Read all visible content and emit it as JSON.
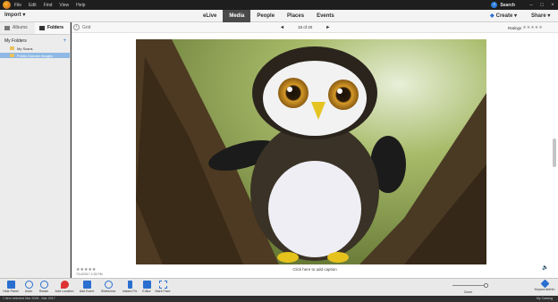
{
  "menubar": {
    "items": [
      "File",
      "Edit",
      "Find",
      "View",
      "Help"
    ],
    "search_label": "Search",
    "window_controls": [
      "–",
      "□",
      "×"
    ]
  },
  "topnav": {
    "import_label": "Import",
    "tabs": [
      "eLive",
      "Media",
      "People",
      "Places",
      "Events"
    ],
    "active_tab": "Media",
    "create_label": "Create",
    "share_label": "Share"
  },
  "left_panel": {
    "tabs": [
      "Albums",
      "Folders"
    ],
    "active_tab": "Folders",
    "section_title": "My Folders",
    "folders": [
      "My Scans",
      "Public Domain Images"
    ],
    "selected_folder": "Public Domain Images"
  },
  "main": {
    "view_label": "Grid",
    "pager_text": "18 of 20",
    "ratings_label": "Ratings",
    "rating_stars": "★★★★★",
    "photo_stars": "★★★★★",
    "photo_date": "7/14/2017 2:33 PM",
    "caption_hint": "Click here to add caption"
  },
  "toolbar": {
    "tools": [
      {
        "label": "Hide Panel",
        "icon": "hide-panel-icon"
      },
      {
        "label": "Undo",
        "icon": "undo-icon"
      },
      {
        "label": "Rotate",
        "icon": "rotate-icon"
      },
      {
        "label": "Add Location",
        "icon": "location-pin-icon"
      },
      {
        "label": "Add Event",
        "icon": "event-icon"
      },
      {
        "label": "Slideshow",
        "icon": "slideshow-icon"
      },
      {
        "label": "Instant Fix",
        "icon": "instant-fix-icon"
      },
      {
        "label": "Editor",
        "icon": "editor-icon"
      },
      {
        "label": "Mark Face",
        "icon": "mark-face-icon"
      }
    ],
    "zoom_label": "Zoom",
    "zoom_level": 0.92,
    "keyword_label": "Keywords/Info"
  },
  "statusbar": {
    "text": "1 item selected   Mar 2008 - Mar 2017",
    "catalog": "My Catalog"
  },
  "colors": {
    "accent_blue": "#2a6fd0",
    "active_tab_bg": "#4a4a4a",
    "selected_folder_bg": "#8fb9e4"
  }
}
